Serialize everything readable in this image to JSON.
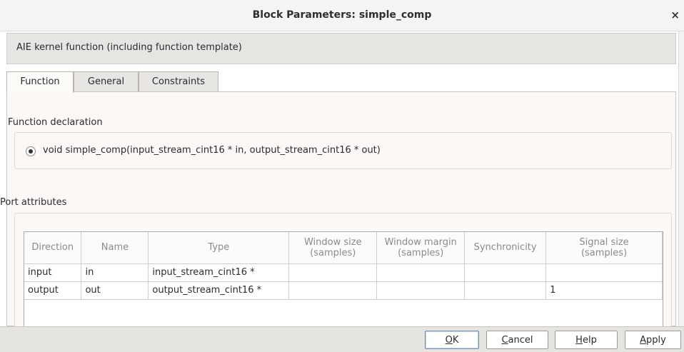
{
  "window": {
    "title": "Block Parameters: simple_comp",
    "close_glyph": "×"
  },
  "description": "AIE kernel function (including function template)",
  "tabs": [
    {
      "label": "Function",
      "active": true
    },
    {
      "label": "General",
      "active": false
    },
    {
      "label": "Constraints",
      "active": false
    }
  ],
  "function_section": {
    "label": "Function declaration",
    "declaration": "void simple_comp(input_stream_cint16 * in, output_stream_cint16 * out)",
    "selected": true
  },
  "ports_section": {
    "label": "Port attributes",
    "headers": [
      [
        "Direction"
      ],
      [
        "Name"
      ],
      [
        "Type"
      ],
      [
        "Window size",
        "(samples)"
      ],
      [
        "Window margin",
        "(samples)"
      ],
      [
        "Synchronicity"
      ],
      [
        "Signal size",
        "(samples)"
      ]
    ],
    "rows": [
      [
        "input",
        "in",
        "input_stream_cint16 *",
        "",
        "",
        "",
        ""
      ],
      [
        "output",
        "out",
        "output_stream_cint16 *",
        "",
        "",
        "",
        "1"
      ]
    ]
  },
  "buttons": {
    "ok": {
      "mnemonic": "O",
      "rest": "K"
    },
    "cancel": {
      "mnemonic": "C",
      "rest": "ancel"
    },
    "help": {
      "mnemonic": "H",
      "rest": "elp"
    },
    "apply": {
      "mnemonic": "A",
      "rest": "pply"
    }
  },
  "icons": {
    "close": "close-icon",
    "radio": "radio-selected-icon"
  }
}
